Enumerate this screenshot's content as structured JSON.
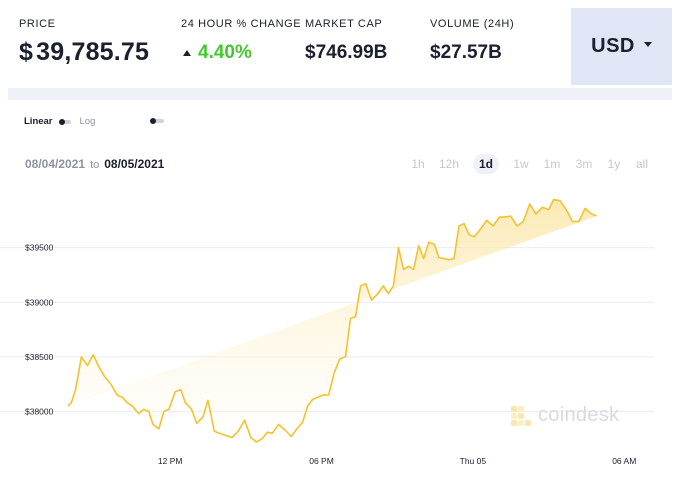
{
  "stats": {
    "price": {
      "label": "PRICE",
      "currency_symbol": "$",
      "value": "39,785.75"
    },
    "change": {
      "label": "24 HOUR % CHANGE",
      "value": "4.40%"
    },
    "market_cap": {
      "label": "MARKET CAP",
      "value": "$746.99B"
    },
    "volume": {
      "label": "VOLUME (24H)",
      "value": "$27.57B"
    }
  },
  "currency_selector": {
    "value": "USD"
  },
  "scale": {
    "linear_label": "Linear",
    "log_label": "Log"
  },
  "range": {
    "start": "08/04/2021",
    "to": "to",
    "end": "08/05/2021"
  },
  "periods": [
    {
      "label": "1h"
    },
    {
      "label": "12h"
    },
    {
      "label": "1d",
      "active": true
    },
    {
      "label": "1w"
    },
    {
      "label": "1m"
    },
    {
      "label": "3m"
    },
    {
      "label": "1y"
    },
    {
      "label": "all"
    }
  ],
  "watermark": {
    "text": "coindesk"
  },
  "colors": {
    "line": "#f2c230",
    "fill_top": "#fbe6a6",
    "positive": "#43c92e",
    "button_bg": "#e0e6f5"
  },
  "chart_data": {
    "type": "area",
    "y_ticks": [
      38000,
      38500,
      39000,
      39500
    ],
    "y_tick_labels": [
      "$38000",
      "$38500",
      "$39000",
      "$39500"
    ],
    "x_tick_labels": [
      {
        "label": "12 PM",
        "x": 7
      },
      {
        "label": "06 PM",
        "x": 13
      },
      {
        "label": "Thu 05",
        "x": 19
      },
      {
        "label": "06 AM",
        "x": 25
      }
    ],
    "xlim": [
      2.95,
      26.1
    ],
    "ylim": [
      37720,
      40120
    ],
    "x": [
      2.95,
      3.08,
      3.25,
      3.48,
      3.72,
      3.95,
      4.15,
      4.4,
      4.65,
      4.9,
      5.1,
      5.3,
      5.5,
      5.75,
      5.95,
      6.15,
      6.32,
      6.55,
      6.75,
      6.95,
      7.2,
      7.42,
      7.6,
      7.85,
      8.05,
      8.3,
      8.5,
      8.75,
      8.95,
      9.2,
      9.45,
      9.7,
      9.95,
      10.2,
      10.42,
      10.65,
      10.85,
      11.05,
      11.3,
      11.55,
      11.8,
      12.05,
      12.25,
      12.45,
      12.65,
      12.85,
      13.05,
      13.28,
      13.5,
      13.72,
      13.95,
      14.15,
      14.35,
      14.55,
      14.75,
      14.98,
      15.2,
      15.45,
      15.65,
      15.85,
      16.05,
      16.25,
      16.45,
      16.65,
      16.85,
      17.05,
      17.25,
      17.48,
      17.65,
      17.85,
      18.05,
      18.25,
      18.45,
      18.65,
      18.85,
      19.05,
      19.3,
      19.55,
      19.8,
      20.05,
      20.25,
      20.5,
      20.75,
      21.0,
      21.25,
      21.5,
      21.75,
      22.0,
      22.2,
      22.45,
      22.7,
      22.95,
      23.2,
      23.45,
      23.7,
      23.9,
      24.15,
      24.4,
      24.6,
      24.85,
      25.1,
      25.3,
      25.55,
      25.8,
      26.05
    ],
    "y": [
      38050,
      38080,
      38200,
      38500,
      38420,
      38520,
      38420,
      38320,
      38250,
      38150,
      38130,
      38080,
      38050,
      37980,
      38020,
      38000,
      37880,
      37840,
      38000,
      38020,
      38180,
      38200,
      38080,
      38020,
      37890,
      37950,
      38100,
      37820,
      37800,
      37780,
      37760,
      37820,
      37920,
      37760,
      37720,
      37750,
      37810,
      37800,
      37880,
      37830,
      37770,
      37850,
      37900,
      38050,
      38110,
      38130,
      38150,
      38150,
      38350,
      38480,
      38500,
      38850,
      38870,
      39150,
      39170,
      39020,
      39070,
      39150,
      39080,
      39150,
      39500,
      39300,
      39330,
      39300,
      39520,
      39400,
      39550,
      39530,
      39410,
      39400,
      39390,
      39400,
      39700,
      39720,
      39620,
      39600,
      39670,
      39750,
      39700,
      39780,
      39780,
      39790,
      39700,
      39740,
      39900,
      39810,
      39870,
      39850,
      39940,
      39930,
      39850,
      39740,
      39740,
      39860,
      39810,
      39790
    ]
  }
}
